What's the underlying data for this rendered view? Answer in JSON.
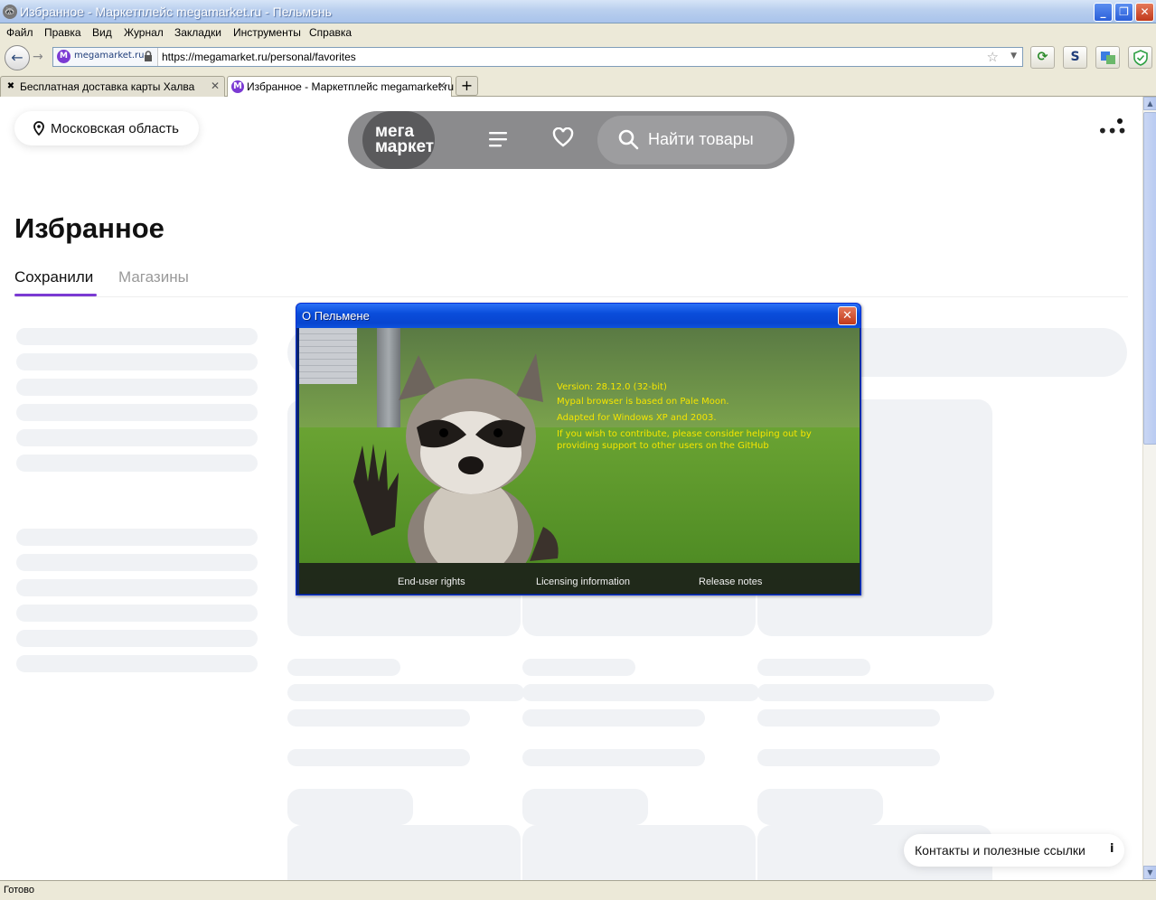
{
  "window": {
    "title": "Избранное - Маркетплейс megamarket.ru - Пельмень",
    "minimize_label": "_",
    "restore_label": "❐",
    "close_label": "✕"
  },
  "menu": [
    "Файл",
    "Правка",
    "Вид",
    "Журнал",
    "Закладки",
    "Инструменты",
    "Справка"
  ],
  "nav": {
    "back_glyph": "←",
    "forward_glyph": "→",
    "identity_domain": "megamarket.ru",
    "favicon_letter": "M",
    "url": "https://megamarket.ru/personal/favorites",
    "bookmark_star": "☆",
    "reload_glyph": "⟳",
    "s_label": "S"
  },
  "tabs": [
    {
      "label": "Бесплатная доставка карты Халва",
      "favicon": "✖",
      "active": false
    },
    {
      "label": "Избранное - Маркетплейс megamarket.ru",
      "favicon": "M",
      "active": true
    }
  ],
  "new_tab_label": "+",
  "site": {
    "region": "Московская область",
    "logo_line1": "мега",
    "logo_line2": "маркет",
    "search_placeholder": "Найти товары",
    "more_label": "•••",
    "page_title": "Избранное",
    "tabs": [
      "Сохранили",
      "Магазины"
    ],
    "contacts": "Контакты и полезные ссылки",
    "info_glyph": "i"
  },
  "status": "Готово",
  "about_dialog": {
    "title": "О Пельмене",
    "close_glyph": "✕",
    "lines": [
      "Version: 28.12.0 (32-bit)",
      "Mypal browser is based on Pale Moon.",
      "Adapted for Windows XP and 2003.",
      "If you wish to contribute, please consider helping out by",
      "providing support to other users on the GitHub"
    ],
    "links": [
      "End-user rights",
      "Licensing information",
      "Release notes"
    ]
  },
  "colors": {
    "accent_purple": "#7b3ad3",
    "xp_blue": "#0a4ddb",
    "skeleton": "#f0f2f5",
    "version_text": "#f5e500"
  }
}
